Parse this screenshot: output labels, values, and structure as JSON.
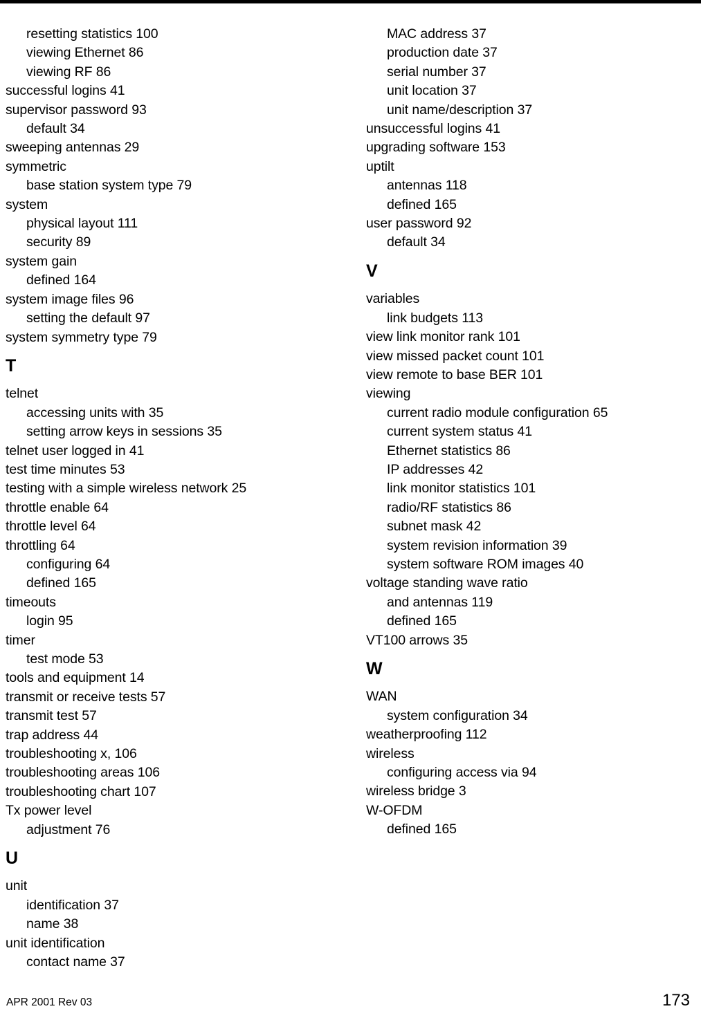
{
  "page": {
    "number": "173",
    "footer_left": "APR 2001 Rev 03"
  },
  "columns": [
    {
      "name": "left-column",
      "blocks": [
        {
          "type": "entry",
          "level": 2,
          "text": "resetting statistics 100"
        },
        {
          "type": "entry",
          "level": 2,
          "text": "viewing Ethernet 86"
        },
        {
          "type": "entry",
          "level": 2,
          "text": "viewing RF 86"
        },
        {
          "type": "entry",
          "level": 1,
          "text": "successful logins 41"
        },
        {
          "type": "entry",
          "level": 1,
          "text": "supervisor password 93"
        },
        {
          "type": "entry",
          "level": 2,
          "text": "default 34"
        },
        {
          "type": "entry",
          "level": 1,
          "text": "sweeping antennas 29"
        },
        {
          "type": "entry",
          "level": 1,
          "text": "symmetric"
        },
        {
          "type": "entry",
          "level": 2,
          "text": "base station system type 79"
        },
        {
          "type": "entry",
          "level": 1,
          "text": "system"
        },
        {
          "type": "entry",
          "level": 2,
          "text": "physical layout 111"
        },
        {
          "type": "entry",
          "level": 2,
          "text": "security 89"
        },
        {
          "type": "entry",
          "level": 1,
          "text": "system gain"
        },
        {
          "type": "entry",
          "level": 2,
          "text": "defined 164"
        },
        {
          "type": "entry",
          "level": 1,
          "text": "system image files 96"
        },
        {
          "type": "entry",
          "level": 2,
          "text": "setting the default 97"
        },
        {
          "type": "entry",
          "level": 1,
          "text": "system symmetry type 79"
        },
        {
          "type": "heading",
          "text": "T"
        },
        {
          "type": "entry",
          "level": 1,
          "text": "telnet"
        },
        {
          "type": "entry",
          "level": 2,
          "text": "accessing units with 35"
        },
        {
          "type": "entry",
          "level": 2,
          "text": "setting arrow keys in sessions 35"
        },
        {
          "type": "entry",
          "level": 1,
          "text": "telnet user logged in 41"
        },
        {
          "type": "entry",
          "level": 1,
          "text": "test time minutes 53"
        },
        {
          "type": "entry",
          "level": 1,
          "text": "testing with a simple wireless network 25"
        },
        {
          "type": "entry",
          "level": 1,
          "text": "throttle enable 64"
        },
        {
          "type": "entry",
          "level": 1,
          "text": "throttle level 64"
        },
        {
          "type": "entry",
          "level": 1,
          "text": "throttling 64"
        },
        {
          "type": "entry",
          "level": 2,
          "text": "configuring 64"
        },
        {
          "type": "entry",
          "level": 2,
          "text": "defined 165"
        },
        {
          "type": "entry",
          "level": 1,
          "text": "timeouts"
        },
        {
          "type": "entry",
          "level": 2,
          "text": "login 95"
        },
        {
          "type": "entry",
          "level": 1,
          "text": "timer"
        },
        {
          "type": "entry",
          "level": 2,
          "text": "test mode 53"
        },
        {
          "type": "entry",
          "level": 1,
          "text": "tools and equipment 14"
        },
        {
          "type": "entry",
          "level": 1,
          "text": "transmit or receive tests 57"
        },
        {
          "type": "entry",
          "level": 1,
          "text": "transmit test 57"
        },
        {
          "type": "entry",
          "level": 1,
          "text": "trap address 44"
        },
        {
          "type": "entry",
          "level": 1,
          "text": "troubleshooting x, 106"
        },
        {
          "type": "entry",
          "level": 1,
          "text": "troubleshooting areas 106"
        },
        {
          "type": "entry",
          "level": 1,
          "text": "troubleshooting chart 107"
        },
        {
          "type": "entry",
          "level": 1,
          "text": "Tx power level"
        },
        {
          "type": "entry",
          "level": 2,
          "text": "adjustment 76"
        },
        {
          "type": "heading",
          "text": "U"
        },
        {
          "type": "entry",
          "level": 1,
          "text": "unit"
        },
        {
          "type": "entry",
          "level": 2,
          "text": "identification 37"
        },
        {
          "type": "entry",
          "level": 2,
          "text": "name 38"
        },
        {
          "type": "entry",
          "level": 1,
          "text": "unit identification"
        },
        {
          "type": "entry",
          "level": 2,
          "text": "contact name 37"
        }
      ]
    },
    {
      "name": "right-column",
      "blocks": [
        {
          "type": "entry",
          "level": 2,
          "text": "MAC address 37"
        },
        {
          "type": "entry",
          "level": 2,
          "text": "production date 37"
        },
        {
          "type": "entry",
          "level": 2,
          "text": "serial number 37"
        },
        {
          "type": "entry",
          "level": 2,
          "text": "unit location 37"
        },
        {
          "type": "entry",
          "level": 2,
          "text": "unit name/description 37"
        },
        {
          "type": "entry",
          "level": 1,
          "text": "unsuccessful logins 41"
        },
        {
          "type": "entry",
          "level": 1,
          "text": "upgrading software 153"
        },
        {
          "type": "entry",
          "level": 1,
          "text": "uptilt"
        },
        {
          "type": "entry",
          "level": 2,
          "text": "antennas 118"
        },
        {
          "type": "entry",
          "level": 2,
          "text": "defined 165"
        },
        {
          "type": "entry",
          "level": 1,
          "text": "user password 92"
        },
        {
          "type": "entry",
          "level": 2,
          "text": "default 34"
        },
        {
          "type": "heading",
          "text": "V"
        },
        {
          "type": "entry",
          "level": 1,
          "text": "variables"
        },
        {
          "type": "entry",
          "level": 2,
          "text": "link budgets 113"
        },
        {
          "type": "entry",
          "level": 1,
          "text": "view link monitor rank 101"
        },
        {
          "type": "entry",
          "level": 1,
          "text": "view missed packet count 101"
        },
        {
          "type": "entry",
          "level": 1,
          "text": "view remote to base BER 101"
        },
        {
          "type": "entry",
          "level": 1,
          "text": "viewing"
        },
        {
          "type": "entry",
          "level": 2,
          "text": "current radio module configuration 65"
        },
        {
          "type": "entry",
          "level": 2,
          "text": "current system status 41"
        },
        {
          "type": "entry",
          "level": 2,
          "text": "Ethernet statistics 86"
        },
        {
          "type": "entry",
          "level": 2,
          "text": "IP addresses 42"
        },
        {
          "type": "entry",
          "level": 2,
          "text": "link monitor statistics 101"
        },
        {
          "type": "entry",
          "level": 2,
          "text": "radio/RF statistics 86"
        },
        {
          "type": "entry",
          "level": 2,
          "text": "subnet mask 42"
        },
        {
          "type": "entry",
          "level": 2,
          "text": "system revision information 39"
        },
        {
          "type": "entry",
          "level": 2,
          "text": "system software ROM images 40"
        },
        {
          "type": "entry",
          "level": 1,
          "text": "voltage standing wave ratio"
        },
        {
          "type": "entry",
          "level": 2,
          "text": "and antennas 119"
        },
        {
          "type": "entry",
          "level": 2,
          "text": "defined 165"
        },
        {
          "type": "entry",
          "level": 1,
          "text": "VT100 arrows 35"
        },
        {
          "type": "heading",
          "text": "W"
        },
        {
          "type": "entry",
          "level": 1,
          "text": "WAN"
        },
        {
          "type": "entry",
          "level": 2,
          "text": "system configuration 34"
        },
        {
          "type": "entry",
          "level": 1,
          "text": "weatherproofing 112"
        },
        {
          "type": "entry",
          "level": 1,
          "text": "wireless"
        },
        {
          "type": "entry",
          "level": 2,
          "text": "configuring access via 94"
        },
        {
          "type": "entry",
          "level": 1,
          "text": "wireless bridge 3"
        },
        {
          "type": "entry",
          "level": 1,
          "text": "W-OFDM"
        },
        {
          "type": "entry",
          "level": 2,
          "text": "defined 165"
        }
      ]
    }
  ]
}
